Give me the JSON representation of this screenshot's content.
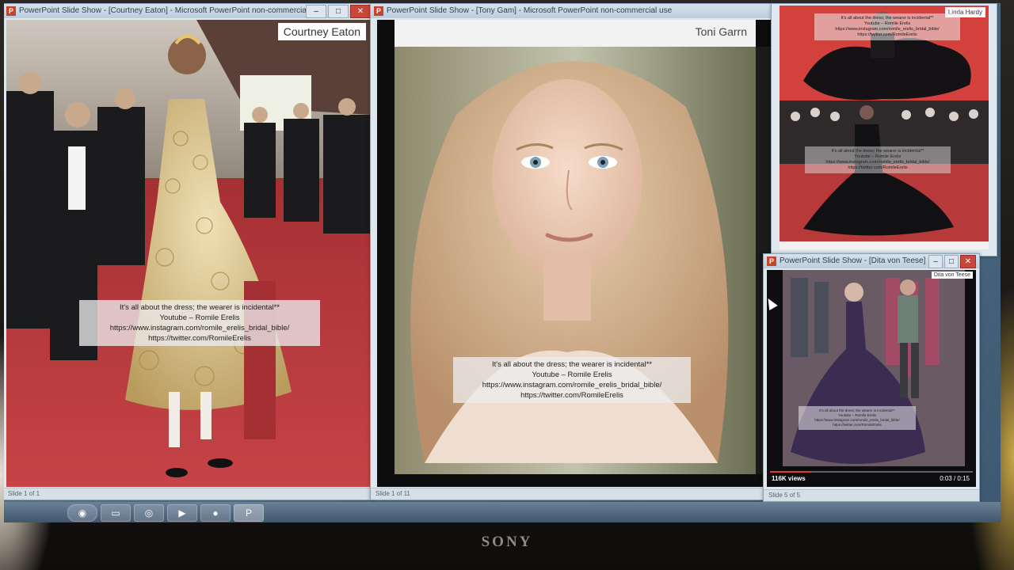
{
  "windows": {
    "left": {
      "title": "PowerPoint Slide Show - [Courtney Eaton] - Microsoft PowerPoint non-commercial use",
      "name_label": "Courtney Eaton",
      "caption": [
        "It's all about the dress; the wearer is incidental**",
        "Youtube – Romile Erelis",
        "https://www.instagram.com/romile_erelis_bridal_bible/",
        "https://twitter.com/RomileErelis"
      ],
      "status": "Slide 1 of 1"
    },
    "center": {
      "title": "PowerPoint Slide Show - [Tony Gam] - Microsoft PowerPoint non-commercial use",
      "name_label": "Toni Garrn",
      "caption": [
        "It's all about the dress; the wearer is incidental**",
        "Youtube – Romile Erelis",
        "https://www.instagram.com/romile_erelis_bridal_bible/",
        "https://twitter.com/RomileErelis"
      ],
      "status": "Slide 1 of 11"
    },
    "top_right": {
      "name_label": "Linda Hardy",
      "caption": [
        "It's all about the dress; the wearer is incidental**",
        "Youtube – Romile Erelis",
        "https://www.instagram.com/romile_erelis_bridal_bible/",
        "https://twitter.com/RomileErelis"
      ]
    },
    "bottom_right": {
      "title": "PowerPoint Slide Show - [Dita von Teese]",
      "name_label": "Dita von Teese",
      "caption": [
        "It's all about the dress; the wearer is incidental**",
        "Youtube – Romile Erelis",
        "https://www.instagram.com/romile_erelis_bridal_bible/",
        "https://twitter.com/RomileErelis"
      ],
      "views": "116K views",
      "time": "0:03 / 0:15",
      "progress": 0.2,
      "status": "Slide 5 of 5"
    }
  },
  "monitor": {
    "brand": "SONY"
  },
  "colors": {
    "red_carpet": "#b8383a",
    "title_bar": "#c7d6e4",
    "close": "#c9463b"
  }
}
